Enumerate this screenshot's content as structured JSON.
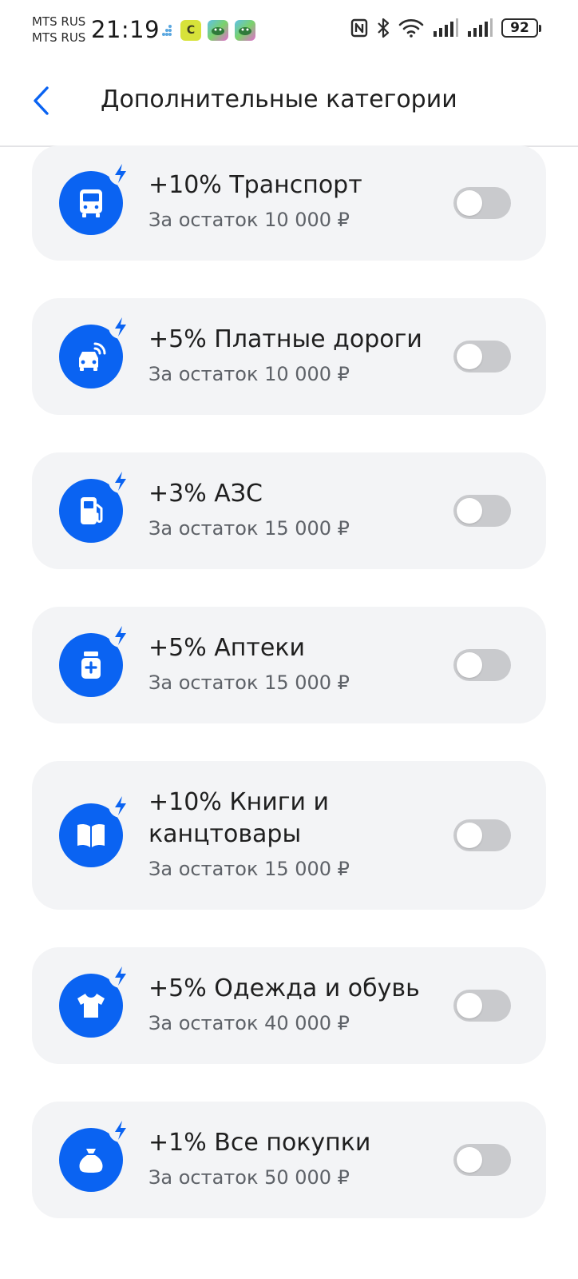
{
  "status_bar": {
    "carrier_1": "MTS RUS",
    "carrier_2": "MTS RUS",
    "time": "21:19",
    "notif_app_1_letter": "C",
    "battery": "92",
    "icons": [
      "nfc-icon",
      "bluetooth-icon",
      "wifi-icon",
      "signal-icon",
      "signal-icon",
      "battery-icon"
    ]
  },
  "header": {
    "back_icon": "chevron-left-icon",
    "title": "Дополнительные категории"
  },
  "colors": {
    "accent": "#0a63f2",
    "card_bg": "#f3f4f6",
    "toggle_off": "#c9cacd",
    "subtitle": "#5e6268"
  },
  "categories": [
    {
      "title": "+10% Транспорт",
      "subtitle": "За остаток 10 000 ₽",
      "icon": "bus-icon",
      "enabled": false
    },
    {
      "title": "+5% Платные дороги",
      "subtitle": "За остаток 10 000 ₽",
      "icon": "car-signal-icon",
      "enabled": false
    },
    {
      "title": "+3% АЗС",
      "subtitle": "За остаток 15 000 ₽",
      "icon": "fuel-pump-icon",
      "enabled": false
    },
    {
      "title": "+5% Аптеки",
      "subtitle": "За остаток 15 000 ₽",
      "icon": "medicine-bottle-icon",
      "enabled": false
    },
    {
      "title": "+10% Книги и канцтовары",
      "subtitle": "За остаток 15 000 ₽",
      "icon": "book-icon",
      "enabled": false
    },
    {
      "title": "+5% Одежда и обувь",
      "subtitle": "За остаток 40 000 ₽",
      "icon": "tshirt-icon",
      "enabled": false
    },
    {
      "title": "+1% Все покупки",
      "subtitle": "За остаток 50 000 ₽",
      "icon": "money-bag-icon",
      "enabled": false
    }
  ]
}
